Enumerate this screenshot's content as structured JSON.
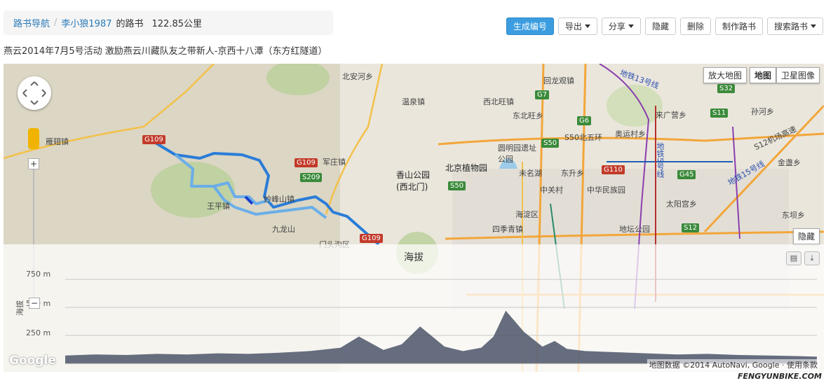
{
  "breadcrumb": {
    "root": "路书导航",
    "user": "李小狼1987",
    "suffix": "的路书",
    "distance": "122.85公里"
  },
  "toolbar": {
    "generate": "生成编号",
    "export": "导出",
    "share": "分享",
    "hide": "隐藏",
    "delete": "删除",
    "make": "制作路书",
    "search": "搜索路书"
  },
  "subtitle": "燕云2014年7月5号活动 激励燕云川藏队友之带新人-京西十八潭（东方红隧道）",
  "map": {
    "enlarge": "放大地图",
    "map_label": "地图",
    "satellite": "卫星图像",
    "hide_label": "隐藏",
    "labels": {
      "beian": "北安河乡",
      "wenquan": "温泉镇",
      "huilong": "回龙观镇",
      "xibeiwang": "西北旺镇",
      "dongbeiwang": "东北旺乡",
      "yuanmingyuan": "圆明园遗址公园",
      "xiangshan": "香山公园(西北门)",
      "zhiwuyuan": "北京植物园",
      "weimingu": "未名湖",
      "dongsheng": "东升乡",
      "zhongguancun": "中关村",
      "minzu": "中华民族园",
      "haidian": "海淀区",
      "siji": "四季青镇",
      "ditan": "地坛公园",
      "taiyang": "太阳宫乡",
      "aoyun": "奥运村乡",
      "laiguang": "来广营乡",
      "sunhe": "孙河乡",
      "jinzhan": "金盏乡",
      "dongba": "东坝乡",
      "yanchi": "雁翅镇",
      "junzhuang": "军庄镇",
      "miaofeng": "妙峰山镇",
      "wangping": "王平镇",
      "jiulong": "九龙山",
      "line13": "地铁13号线",
      "line5": "地铁5号线",
      "line15": "地铁15号线",
      "airport": "S12机场高速",
      "ring": "S50北五环",
      "sanhuan": "门头沟区"
    },
    "shields": {
      "g109a": "G109",
      "g109b": "G109",
      "g109c": "G109",
      "s209": "S209",
      "g7": "G7",
      "g6": "G6",
      "s50a": "S50",
      "s50b": "S50",
      "g110": "G110",
      "s32": "S32",
      "s11": "S11",
      "g45": "G45",
      "s12": "S12"
    },
    "google": "Google",
    "attribution": "地图数据 ©2014 AutoNavi, Google · 使用条款",
    "watermark": "FENGYUNBIKE.COM"
  },
  "elevation": {
    "title": "海拔",
    "ylabel": "海拔",
    "ticks": [
      "750 m",
      "500 m",
      "250 m"
    ],
    "tick_values": [
      750,
      500,
      250
    ],
    "icons": [
      "print-icon",
      "download-icon"
    ]
  },
  "chart_data": {
    "type": "area",
    "title": "海拔",
    "ylabel": "海拔",
    "xlabel": "",
    "ylim": [
      0,
      800
    ],
    "x": [
      0,
      5,
      10,
      15,
      20,
      25,
      30,
      35,
      40,
      45,
      48,
      52,
      55,
      58,
      62,
      65,
      68,
      70,
      72,
      75,
      78,
      80,
      82,
      85,
      90,
      95,
      100,
      105,
      110,
      115,
      120,
      122.85
    ],
    "values": [
      70,
      80,
      75,
      85,
      80,
      90,
      85,
      95,
      110,
      140,
      240,
      120,
      170,
      330,
      150,
      110,
      140,
      240,
      470,
      280,
      150,
      200,
      130,
      110,
      100,
      90,
      80,
      85,
      75,
      70,
      65,
      60
    ],
    "color": "#4c5568"
  },
  "colors": {
    "route_primary": "#2a7dd8",
    "route_light": "#6aaee8",
    "primary_button": "#3b9de0",
    "link": "#2a7ab8"
  }
}
